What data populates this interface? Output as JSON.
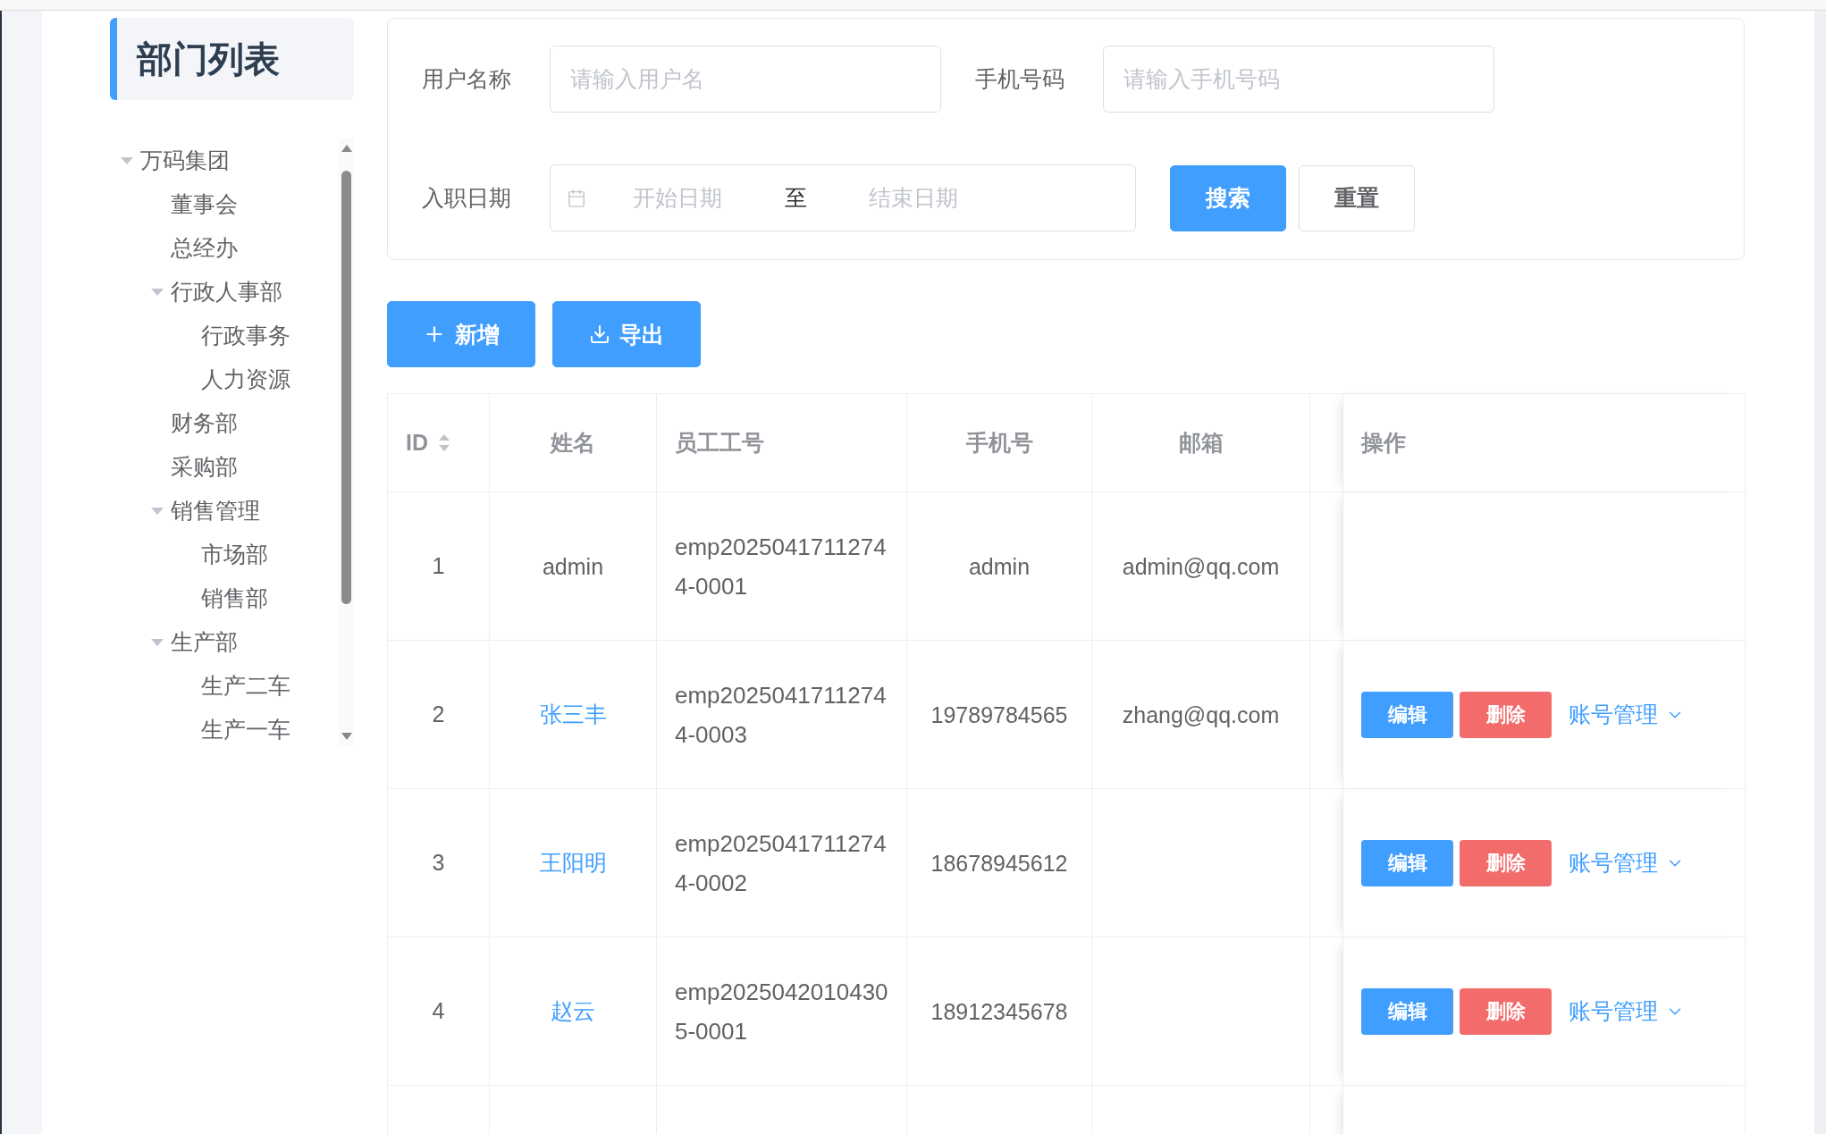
{
  "sidebar": {
    "title": "部门列表",
    "tree": [
      {
        "label": "万码集团",
        "expanded": true,
        "children": [
          {
            "label": "董事会"
          },
          {
            "label": "总经办"
          },
          {
            "label": "行政人事部",
            "expanded": true,
            "children": [
              {
                "label": "行政事务"
              },
              {
                "label": "人力资源"
              }
            ]
          },
          {
            "label": "财务部"
          },
          {
            "label": "采购部"
          },
          {
            "label": "销售管理",
            "expanded": true,
            "children": [
              {
                "label": "市场部"
              },
              {
                "label": "销售部"
              }
            ]
          },
          {
            "label": "生产部",
            "expanded": true,
            "children": [
              {
                "label": "生产二车"
              },
              {
                "label": "生产一车"
              }
            ]
          }
        ]
      }
    ]
  },
  "search": {
    "fields": [
      {
        "label": "用户名称",
        "placeholder": "请输入用户名"
      },
      {
        "label": "手机号码",
        "placeholder": "请输入手机号码"
      }
    ],
    "date_range": {
      "label": "入职日期",
      "start_placeholder": "开始日期",
      "separator": "至",
      "end_placeholder": "结束日期"
    },
    "buttons": [
      {
        "label": "搜索",
        "kind": "primary"
      },
      {
        "label": "重置",
        "kind": "default"
      }
    ]
  },
  "toolbar": [
    {
      "label": "新增",
      "kind": "add"
    },
    {
      "label": "导出",
      "kind": "export"
    }
  ],
  "table": {
    "columns": [
      {
        "label": "ID",
        "sortable": true
      },
      {
        "label": "姓名",
        "sortable": false
      },
      {
        "label": "员工工号",
        "sortable": false
      },
      {
        "label": "手机号",
        "sortable": false
      },
      {
        "label": "邮箱",
        "sortable": false
      },
      {
        "label": "操作",
        "sortable": false
      }
    ],
    "rows": [
      {
        "id": "1",
        "name": "admin",
        "linked": false,
        "emp_no": "emp20250417112744-0001",
        "phone": "admin",
        "email": "admin@qq.com"
      },
      {
        "id": "2",
        "name": "张三丰",
        "linked": true,
        "emp_no": "emp20250417112744-0003",
        "phone": "19789784565",
        "email": "zhang@qq.com",
        "actions": [
          {
            "label": "编辑",
            "kind": "edit"
          },
          {
            "label": "删除",
            "kind": "delete"
          },
          {
            "label": "账号管理",
            "kind": "dropdown"
          }
        ]
      },
      {
        "id": "3",
        "name": "王阳明",
        "linked": true,
        "emp_no": "emp20250417112744-0002",
        "phone": "18678945612",
        "actions": [
          {
            "label": "编辑",
            "kind": "edit"
          },
          {
            "label": "删除",
            "kind": "delete"
          },
          {
            "label": "账号管理",
            "kind": "dropdown"
          }
        ]
      },
      {
        "id": "4",
        "name": "赵云",
        "linked": true,
        "emp_no": "emp20250420104305-0001",
        "phone": "18912345678",
        "actions": [
          {
            "label": "编辑",
            "kind": "edit"
          },
          {
            "label": "删除",
            "kind": "delete"
          },
          {
            "label": "账号管理",
            "kind": "dropdown"
          }
        ]
      }
    ]
  }
}
